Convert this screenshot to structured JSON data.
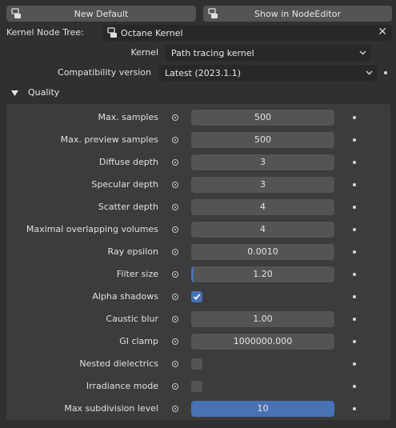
{
  "top_buttons": {
    "new_default": "New Default",
    "show_in_node_editor": "Show in NodeEditor"
  },
  "kernel_node_tree": {
    "label": "Kernel Node Tree:",
    "value": "Octane Kernel",
    "clear_icon": "close-icon"
  },
  "kernel": {
    "label": "Kernel",
    "value": "Path tracing kernel"
  },
  "compatibility": {
    "label": "Compatibility version",
    "value": "Latest (2023.1.1)"
  },
  "quality_panel": {
    "title": "Quality",
    "expanded": true
  },
  "rows": [
    {
      "label": "Max. samples",
      "type": "number",
      "value": "500"
    },
    {
      "label": "Max. preview samples",
      "type": "number",
      "value": "500"
    },
    {
      "label": "Diffuse depth",
      "type": "number",
      "value": "3"
    },
    {
      "label": "Specular depth",
      "type": "number",
      "value": "3"
    },
    {
      "label": "Scatter depth",
      "type": "number",
      "value": "4"
    },
    {
      "label": "Maximal overlapping volumes",
      "type": "number",
      "value": "4"
    },
    {
      "label": "Ray epsilon",
      "type": "number",
      "value": "0.0010"
    },
    {
      "label": "Filter size",
      "type": "slider",
      "value": "1.20",
      "fill_fraction": 0.01
    },
    {
      "label": "Alpha shadows",
      "type": "checkbox",
      "checked": true
    },
    {
      "label": "Caustic blur",
      "type": "number",
      "value": "1.00"
    },
    {
      "label": "GI clamp",
      "type": "number",
      "value": "1000000.000"
    },
    {
      "label": "Nested dielectrics",
      "type": "checkbox",
      "checked": false
    },
    {
      "label": "Irradiance mode",
      "type": "checkbox",
      "checked": false
    },
    {
      "label": "Max subdivision level",
      "type": "slider",
      "value": "10",
      "fill_fraction": 1.0
    }
  ],
  "colors": {
    "accent": "#4772b3",
    "background": "#303030",
    "panel": "#3c3c3c",
    "widget": "#545454"
  }
}
